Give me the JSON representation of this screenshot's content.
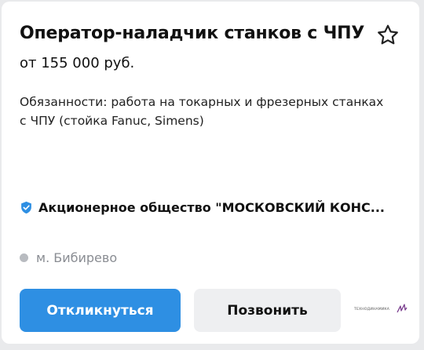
{
  "vacancy": {
    "title": "Оператор-наладчик станков с ЧПУ",
    "salary": "от 155 000 руб.",
    "duties": "Обязанности: работа на токарных и фрезерных станках с ЧПУ (стойка Fanuc, Simens)",
    "company": "Акционерное общество \"МОСКОВСКИЙ КОНСТРУКТОРСКОЕ БЮРО\"",
    "company_display": "Акционерное общество \"МОСКОВСКИЙ КОНС...",
    "metro": "м. Бибирево"
  },
  "actions": {
    "respond_label": "Откликнуться",
    "call_label": "Позвонить"
  },
  "logo": {
    "text": "ТЕХНОДИНАМИКА"
  },
  "icons": {
    "favorite": "star-outline-icon",
    "verified": "verified-shield-icon",
    "metro": "metro-dot-icon"
  },
  "colors": {
    "accent": "#2e8fe3",
    "verified": "#2e8fe3",
    "metro_dot": "#b8bbc0",
    "logo_mark": "#7b3f8f"
  }
}
